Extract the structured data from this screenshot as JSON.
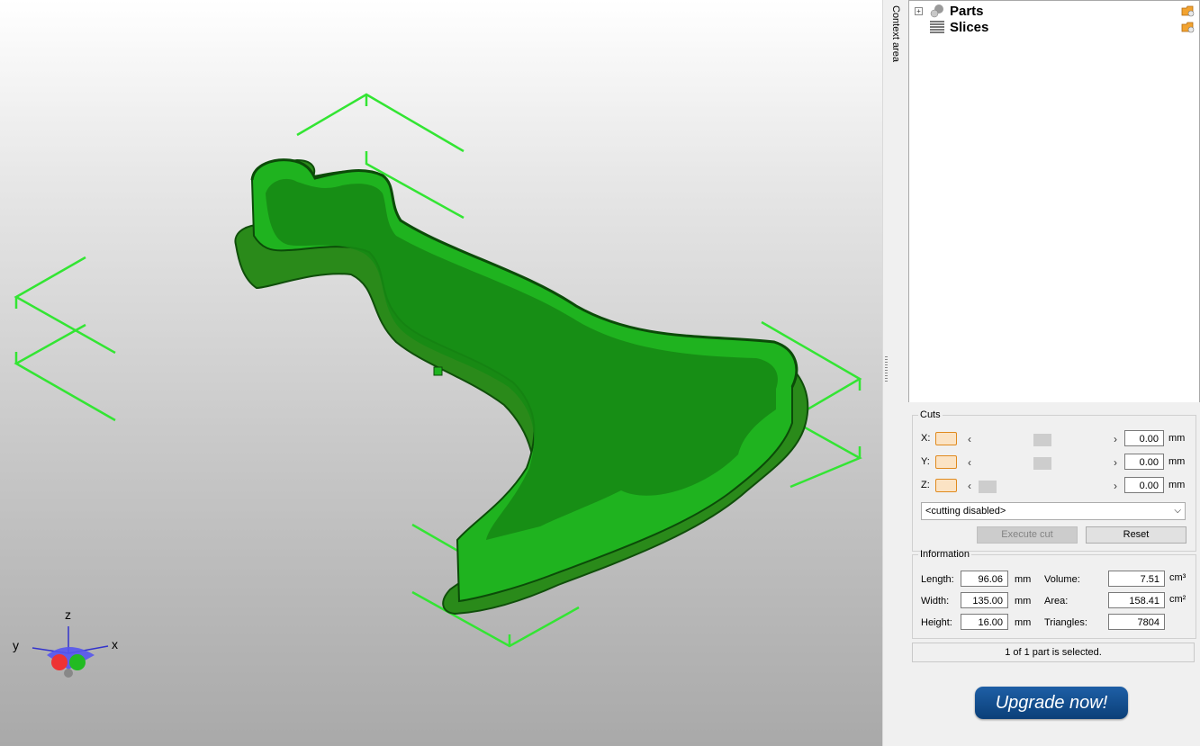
{
  "tree": {
    "items": [
      {
        "label": "Parts",
        "icon": "parts-spheres-icon",
        "expander": "+"
      },
      {
        "label": "Slices",
        "icon": "slices-lines-icon"
      }
    ]
  },
  "context_label": "Context area",
  "cuts": {
    "legend": "Cuts",
    "axes": [
      {
        "label": "X:",
        "value": "0.00",
        "unit": "mm",
        "slider_position": 0.5
      },
      {
        "label": "Y:",
        "value": "0.00",
        "unit": "mm",
        "slider_position": 0.5
      },
      {
        "label": "Z:",
        "value": "0.00",
        "unit": "mm",
        "slider_position": 0.0
      }
    ],
    "mode": "<cutting disabled>",
    "execute_label": "Execute cut",
    "reset_label": "Reset"
  },
  "information": {
    "legend": "Information",
    "length_label": "Length:",
    "length": "96.06",
    "length_unit": "mm",
    "width_label": "Width:",
    "width": "135.00",
    "width_unit": "mm",
    "height_label": "Height:",
    "height": "16.00",
    "height_unit": "mm",
    "volume_label": "Volume:",
    "volume": "7.51",
    "volume_unit": "cm³",
    "area_label": "Area:",
    "area": "158.41",
    "area_unit": "cm²",
    "triangles_label": "Triangles:",
    "triangles": "7804"
  },
  "status": "1 of 1 part is selected.",
  "upgrade_label": "Upgrade now!",
  "axis_gizmo": {
    "x": "x",
    "y": "y",
    "z": "z"
  },
  "colors": {
    "part": "#1fb31f",
    "bbox": "#39e639",
    "upgrade": "#0b3f78"
  }
}
